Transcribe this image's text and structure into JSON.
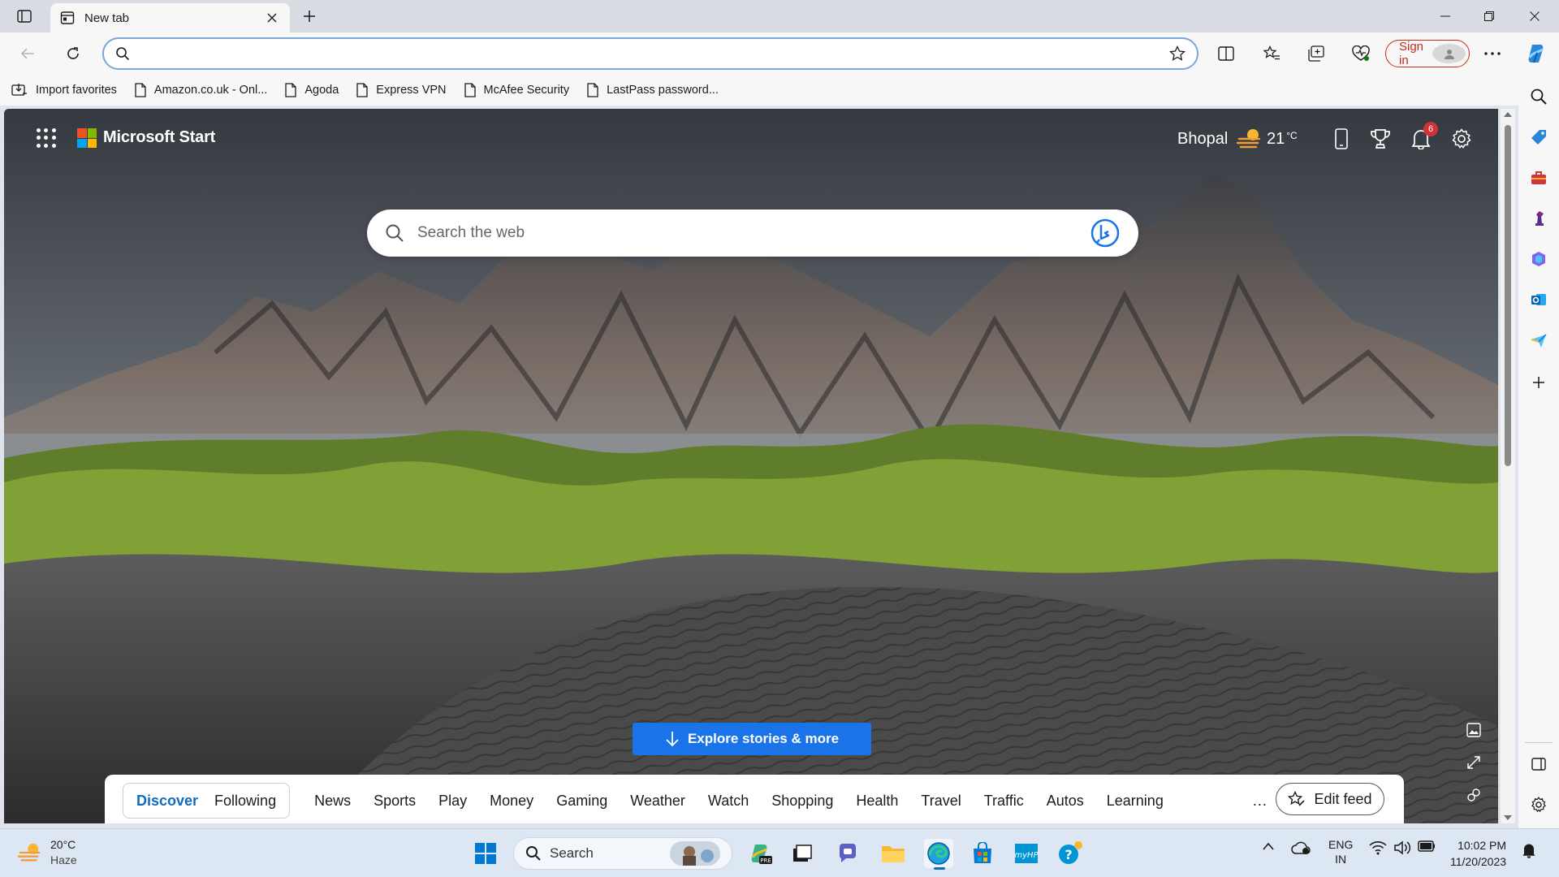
{
  "browser": {
    "tab_title": "New tab",
    "address_value": "",
    "sign_in_label": "Sign in"
  },
  "favorites": [
    {
      "label": "Import favorites",
      "icon": "import-favorites-icon"
    },
    {
      "label": "Amazon.co.uk - Onl...",
      "icon": "page-icon"
    },
    {
      "label": "Agoda",
      "icon": "page-icon"
    },
    {
      "label": "Express VPN",
      "icon": "page-icon"
    },
    {
      "label": "McAfee Security",
      "icon": "page-icon"
    },
    {
      "label": "LastPass password...",
      "icon": "page-icon"
    }
  ],
  "start": {
    "brand": "Microsoft Start",
    "city": "Bhopal",
    "temperature": "21",
    "temperature_unit": "°C",
    "notification_count": "6",
    "search_placeholder": "Search the web",
    "explore_label": "Explore stories & more"
  },
  "feed": {
    "segments": [
      "Discover",
      "Following"
    ],
    "active_segment": "Discover",
    "items": [
      "News",
      "Sports",
      "Play",
      "Money",
      "Gaming",
      "Weather",
      "Watch",
      "Shopping",
      "Health",
      "Travel",
      "Traffic",
      "Autos",
      "Learning"
    ],
    "more_label": "...",
    "edit_label": "Edit feed"
  },
  "taskbar": {
    "weather_temp": "20°C",
    "weather_desc": "Haze",
    "search_label": "Search",
    "lang_line1": "ENG",
    "lang_line2": "IN",
    "time": "10:02 PM",
    "date": "11/20/2023"
  },
  "colors": {
    "accent": "#0f6cbd",
    "explore_button": "#1a73e8",
    "sign_in": "#c42b1c"
  }
}
